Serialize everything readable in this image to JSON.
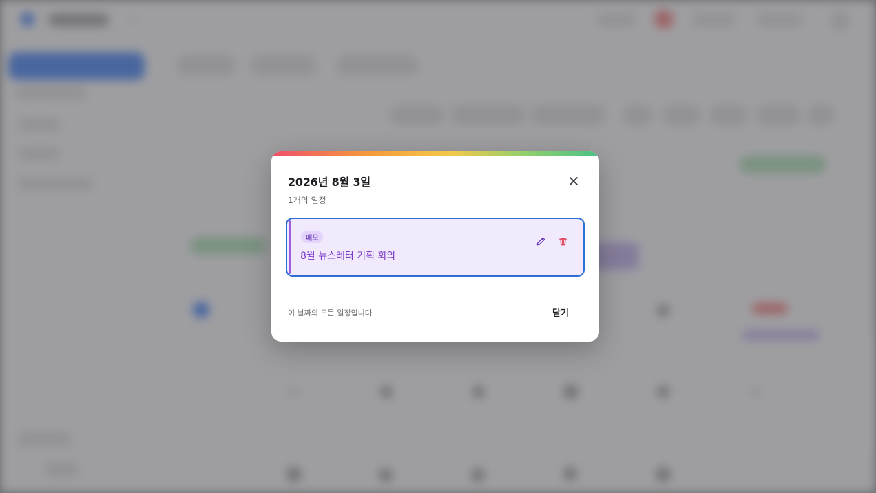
{
  "modal": {
    "title": "2026년 8월 3일",
    "subtitle": "1개의 일정",
    "close_icon": "close-icon",
    "event": {
      "badge": "메모",
      "title": "8월 뉴스레터 기획 회의",
      "edit_icon": "pencil-icon",
      "delete_icon": "trash-icon"
    },
    "footer_note": "이 날짜의 모든 일정입니다",
    "close_label": "닫기"
  },
  "colors": {
    "event_bg": "#f1eafc",
    "event_border": "#2e6fd6",
    "event_text": "#7a39c9",
    "delete_icon": "#e0465e",
    "edit_icon": "#6b3fb8"
  }
}
